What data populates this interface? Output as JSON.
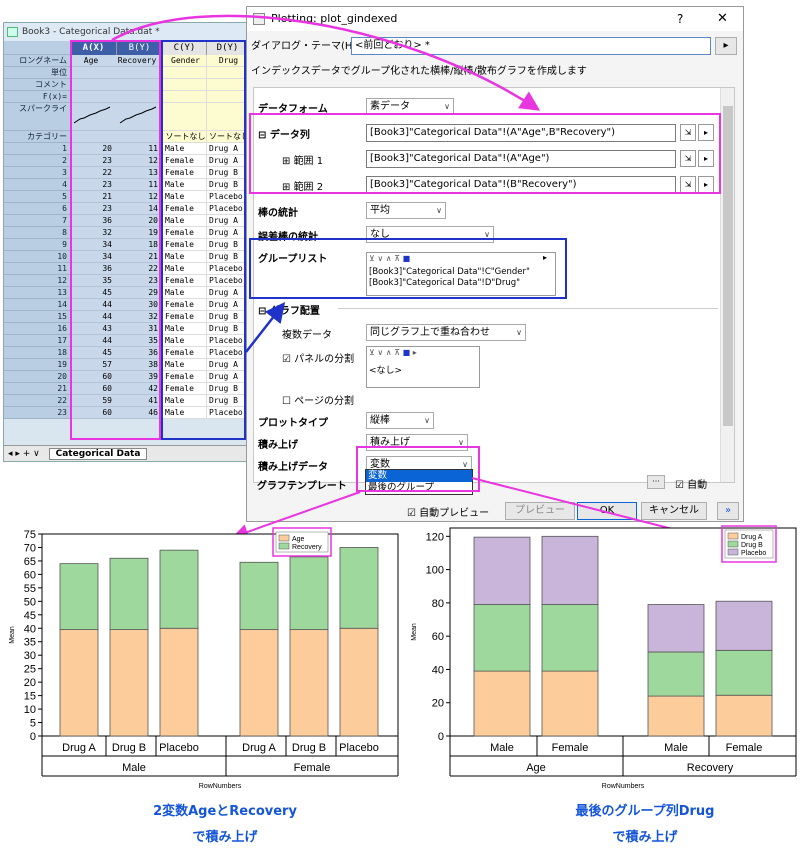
{
  "sheet": {
    "title": "Book3 - Categorical Data.dat *",
    "columns": [
      "A(X)",
      "B(Y)",
      "C(Y)",
      "D(Y)"
    ],
    "long_names": [
      "Age",
      "Recovery",
      "Gender",
      "Drug"
    ],
    "row_labels": {
      "long_name": "ロングネーム",
      "units": "単位",
      "comments": "コメント",
      "fx": "F(x)=",
      "sparkline": "スパークライ",
      "category": "カテゴリー"
    },
    "category_cells": [
      "ソートなし",
      "ソートなし"
    ],
    "rows": [
      [
        "1",
        "20",
        "11",
        "Male",
        "Drug A"
      ],
      [
        "2",
        "23",
        "12",
        "Female",
        "Drug A"
      ],
      [
        "3",
        "22",
        "13",
        "Female",
        "Drug B"
      ],
      [
        "4",
        "23",
        "11",
        "Male",
        "Drug B"
      ],
      [
        "5",
        "21",
        "12",
        "Male",
        "Placebo"
      ],
      [
        "6",
        "23",
        "14",
        "Female",
        "Placebo"
      ],
      [
        "7",
        "36",
        "20",
        "Male",
        "Drug A"
      ],
      [
        "8",
        "32",
        "19",
        "Female",
        "Drug A"
      ],
      [
        "9",
        "34",
        "18",
        "Female",
        "Drug B"
      ],
      [
        "10",
        "34",
        "21",
        "Male",
        "Drug B"
      ],
      [
        "11",
        "36",
        "22",
        "Male",
        "Placebo"
      ],
      [
        "12",
        "35",
        "23",
        "Female",
        "Placebo"
      ],
      [
        "13",
        "45",
        "29",
        "Male",
        "Drug A"
      ],
      [
        "14",
        "44",
        "30",
        "Female",
        "Drug A"
      ],
      [
        "15",
        "44",
        "32",
        "Female",
        "Drug B"
      ],
      [
        "16",
        "43",
        "31",
        "Male",
        "Drug B"
      ],
      [
        "17",
        "44",
        "35",
        "Male",
        "Placebo"
      ],
      [
        "18",
        "45",
        "36",
        "Female",
        "Placebo"
      ],
      [
        "19",
        "57",
        "38",
        "Male",
        "Drug A"
      ],
      [
        "20",
        "60",
        "39",
        "Female",
        "Drug A"
      ],
      [
        "21",
        "60",
        "42",
        "Female",
        "Drug B"
      ],
      [
        "22",
        "59",
        "41",
        "Male",
        "Drug B"
      ],
      [
        "23",
        "60",
        "46",
        "Male",
        "Placebo"
      ]
    ],
    "tab_label": "Categorical Data"
  },
  "dialog": {
    "title": "Plotting: plot_gindexed",
    "help": "?",
    "close": "✕",
    "theme_label": "ダイアログ・テーマ(H)",
    "theme_value": "<前回どおり> *",
    "description": "インデックスデータでグループ化された横棒/縦棒/散布グラフを作成します",
    "data_form_label": "データフォーム",
    "data_form_value": "素データ",
    "data_col_label": "データ列",
    "data_col_value": "[Book3]\"Categorical Data\"!(A\"Age\",B\"Recovery\")",
    "range1_label": "範囲 1",
    "range1_value": "[Book3]\"Categorical Data\"!(A\"Age\")",
    "range2_label": "範囲 2",
    "range2_value": "[Book3]\"Categorical Data\"!(B\"Recovery\")",
    "bar_stat_label": "棒の統計",
    "bar_stat_value": "平均",
    "err_stat_label": "誤差棒の統計",
    "err_stat_value": "なし",
    "group_list_label": "グループリスト",
    "group_list": [
      "[Book3]\"Categorical Data\"!C\"Gender\"",
      "[Book3]\"Categorical Data\"!D\"Drug\""
    ],
    "layout_label": "グラフ配置",
    "multi_data_label": "複数データ",
    "multi_data_value": "同じグラフ上で重ね合わせ",
    "panel_split_label": "パネルの分割",
    "panel_split_value": "<なし>",
    "page_split_label": "ページの分割",
    "plot_type_label": "プロットタイプ",
    "plot_type_value": "縦棒",
    "stack_label": "積み上げ",
    "stack_value": "積み上げ",
    "stack_data_label": "積み上げデータ",
    "stack_data_value": "変数",
    "stack_data_options": [
      "変数",
      "最後のグループ"
    ],
    "template_label": "グラフテンプレート",
    "auto_label": "自動",
    "auto_preview_label": "自動プレビュー",
    "preview_button": "プレビュー",
    "ok_button": "OK",
    "cancel_button": "キャンセル",
    "more_button": "»",
    "dots_button": "···"
  },
  "captions": {
    "left_line1": "2変数AgeとRecovery",
    "left_line2": "で積み上げ",
    "right_line1": "最後のグループ列Drug",
    "right_line2": "で積み上げ"
  },
  "colors": {
    "orange": "#fccc9b",
    "green": "#9ed89c",
    "purple": "#c9b5d9",
    "magenta": "#e835e0",
    "blue": "#1f33c8"
  },
  "chart_data": [
    {
      "type": "bar",
      "stacked": true,
      "categories": [
        "Drug A",
        "Drug B",
        "Placebo",
        "Drug A",
        "Drug B",
        "Placebo"
      ],
      "groups": [
        "Male",
        "Female"
      ],
      "series": [
        {
          "name": "Age",
          "values": [
            39.5,
            39.5,
            40,
            39.5,
            39.5,
            40
          ]
        },
        {
          "name": "Recovery",
          "values": [
            24.5,
            26.5,
            29,
            25,
            27,
            30
          ]
        }
      ],
      "ylabel": "Mean",
      "xlabel": "RowNumbers",
      "ylim": [
        0,
        75
      ],
      "yticks": [
        0,
        5,
        10,
        15,
        20,
        25,
        30,
        35,
        40,
        45,
        50,
        55,
        60,
        65,
        70,
        75
      ],
      "legend": "top-right"
    },
    {
      "type": "bar",
      "stacked": true,
      "categories": [
        "Male",
        "Female",
        "Male",
        "Female"
      ],
      "groups": [
        "Age",
        "Recovery"
      ],
      "series": [
        {
          "name": "Drug A",
          "values": [
            39,
            39,
            24,
            24.5
          ]
        },
        {
          "name": "Drug B",
          "values": [
            40,
            40,
            26.5,
            27
          ]
        },
        {
          "name": "Placebo",
          "values": [
            40.5,
            41,
            28.5,
            29.5
          ]
        }
      ],
      "ylabel": "Mean",
      "xlabel": "RowNumbers",
      "ylim": [
        0,
        125
      ],
      "yticks": [
        0,
        20,
        40,
        60,
        80,
        100,
        120
      ],
      "legend": "top-right"
    }
  ]
}
